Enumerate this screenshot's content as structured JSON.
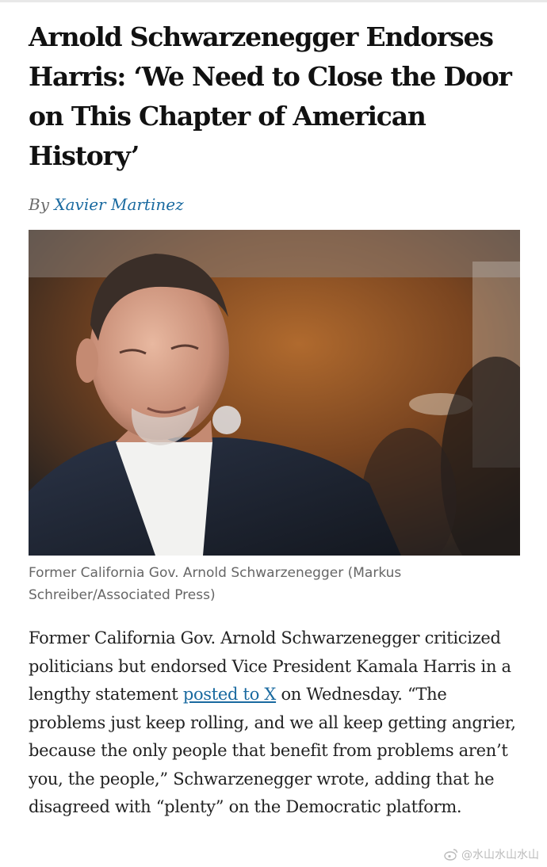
{
  "article": {
    "headline": "Arnold Schwarzenegger Endorses Harris: ‘We Need to Close the Door on This Chapter of American History’",
    "byline_prefix": "By",
    "author": "Xavier Martinez",
    "photo": {
      "alt": "Arnold Schwarzenegger"
    },
    "caption": "Former California Gov. Arnold Schwarzenegger (Markus Schreiber/Associated Press)",
    "body": {
      "part1": "Former California Gov. Arnold Schwarzenegger criticized politicians but endorsed Vice President Kamala Harris in a lengthy statement ",
      "link": "posted to X",
      "part2": " on Wednesday. “The problems just keep rolling, and we all keep getting angrier, because the only people that benefit from problems aren’t you, the people,” Schwarzenegger wrote, adding that he disagreed with “plenty” on the Democratic platform."
    }
  },
  "watermark": {
    "text": "@水山水山水山",
    "icon": "weibo-icon"
  }
}
